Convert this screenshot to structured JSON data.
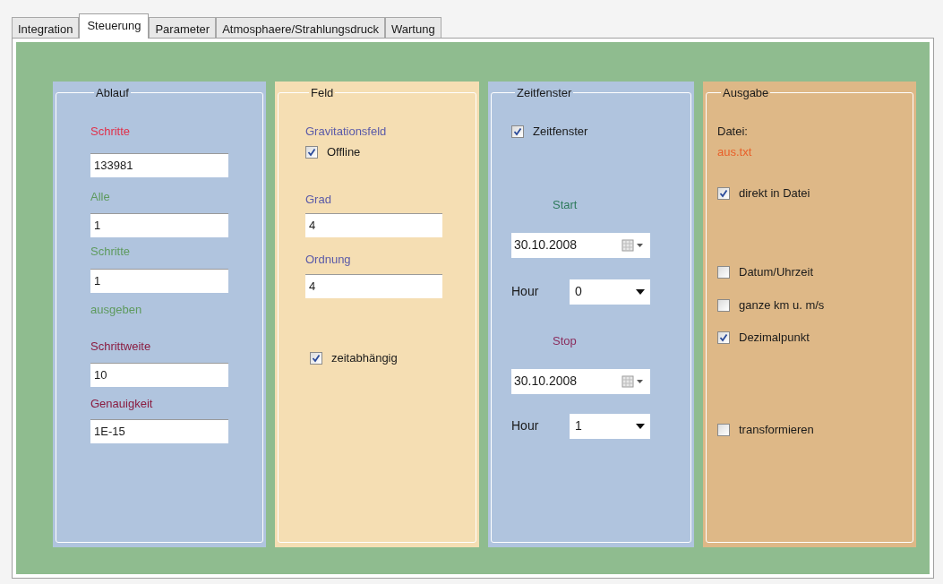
{
  "tabs": [
    {
      "label": "Integration",
      "selected": false
    },
    {
      "label": "Steuerung",
      "selected": true
    },
    {
      "label": "Parameter",
      "selected": false
    },
    {
      "label": "Atmosphaere/Strahlungsdruck",
      "selected": false
    },
    {
      "label": "Wartung",
      "selected": false
    }
  ],
  "groups": [
    {
      "title": "Ablauf",
      "color": "#b0c4de",
      "items": [
        {
          "kind": "label",
          "text": "Schritte",
          "color": "#e0304a"
        },
        {
          "kind": "field",
          "value": "133981"
        },
        {
          "kind": "label",
          "text": "Alle",
          "color": "#5e9a5e"
        },
        {
          "kind": "field",
          "value": "1"
        },
        {
          "kind": "label",
          "text": "Schritte",
          "color": "#5e9a5e"
        },
        {
          "kind": "field",
          "value": "1"
        },
        {
          "kind": "label",
          "text": "ausgeben",
          "color": "#5e9a5e"
        },
        {
          "kind": "label",
          "text": "Schrittweite",
          "color": "#8a1c40"
        },
        {
          "kind": "field",
          "value": "10"
        },
        {
          "kind": "label",
          "text": "Genauigkeit",
          "color": "#8a1c40"
        },
        {
          "kind": "field",
          "value": "1E-15"
        }
      ]
    },
    {
      "title": "Feld",
      "color": "#f5deb3",
      "items": [
        {
          "kind": "label",
          "text": "Gravitationsfeld",
          "color": "#5a5aa8"
        },
        {
          "kind": "checkbox",
          "label": "Offline",
          "checked": true
        },
        {
          "kind": "label",
          "text": "Grad",
          "color": "#5a5aa8"
        },
        {
          "kind": "field",
          "value": "4"
        },
        {
          "kind": "label",
          "text": "Ordnung",
          "color": "#5a5aa8"
        },
        {
          "kind": "field",
          "value": "4"
        },
        {
          "kind": "checkbox",
          "label": "zeitabhängig",
          "checked": true
        }
      ]
    },
    {
      "title": "Zeitfenster",
      "color": "#b0c4de",
      "items": [
        {
          "kind": "checkbox",
          "label": "Zeitfenster",
          "checked": true
        },
        {
          "kind": "label",
          "text": "Start",
          "color": "#2e7a5c"
        },
        {
          "kind": "date",
          "value": "30.10.2008"
        },
        {
          "kind": "hour",
          "label": "Hour",
          "value": "0"
        },
        {
          "kind": "label",
          "text": "Stop",
          "color": "#8a2c5c"
        },
        {
          "kind": "date",
          "value": "30.10.2008"
        },
        {
          "kind": "hour",
          "label": "Hour",
          "value": "1"
        }
      ]
    },
    {
      "title": "Ausgabe",
      "color": "#deb887",
      "items": [
        {
          "kind": "label",
          "text": "Datei:",
          "color": "#1a1a1a"
        },
        {
          "kind": "label",
          "text": "aus.txt",
          "color": "#e8602a"
        },
        {
          "kind": "checkbox",
          "label": "direkt in Datei",
          "checked": true
        },
        {
          "kind": "checkbox",
          "label": "Datum/Uhrzeit",
          "checked": false
        },
        {
          "kind": "checkbox",
          "label": "ganze km u. m/s",
          "checked": false
        },
        {
          "kind": "checkbox",
          "label": "Dezimalpunkt",
          "checked": true
        },
        {
          "kind": "checkbox",
          "label": "transformieren",
          "checked": false
        }
      ]
    }
  ]
}
